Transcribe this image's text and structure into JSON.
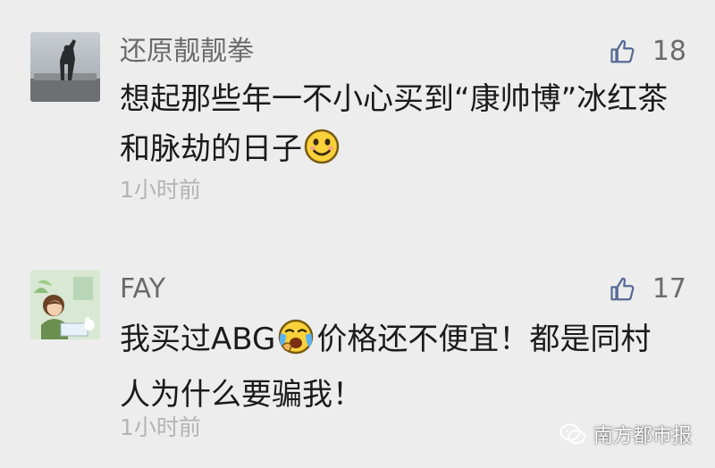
{
  "colors": {
    "background": "#ededed",
    "nickname": "#6b6b6b",
    "content": "#1b1b1b",
    "time": "#b4b4b4",
    "like_icon": "#576b95"
  },
  "comments": [
    {
      "nickname": "还原靓靓拳",
      "likes": "18",
      "content_lines": [
        "想起那些年一不小心买到“康帅博”冰红茶",
        "和脉劫的日子"
      ],
      "emoji": "smile-emoji",
      "time": "1小时前",
      "avatar": "statue-avatar"
    },
    {
      "nickname": "FAY",
      "likes": "17",
      "content_lines": [
        "我买过ABG",
        "价格还不便宜！都是同村",
        "人为什么要骗我！"
      ],
      "emoji": "crying-emoji",
      "time": "1小时前",
      "avatar": "girl-illustration-avatar"
    }
  ],
  "watermark": {
    "text": "南方都市报",
    "icon": "wechat-icon"
  }
}
